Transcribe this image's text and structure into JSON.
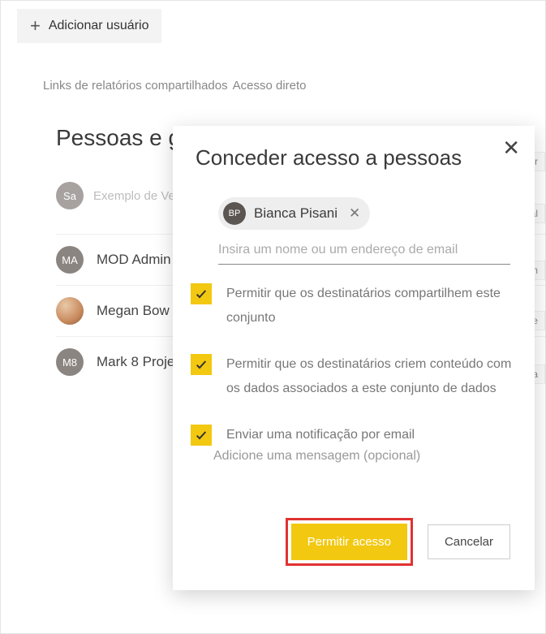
{
  "header": {
    "add_user_label": "Adicionar usuário"
  },
  "tabs": {
    "shared_links": "Links de relatórios compartilhados",
    "direct_access": "Acesso direto"
  },
  "main": {
    "heading_left": "Pessoas e grupos",
    "search_placeholder": "Exemplo de Vendas",
    "rows": [
      {
        "initials": "Sa",
        "name": "Exemplo de Vendas"
      },
      {
        "initials": "MA",
        "name": "MOD Admin"
      },
      {
        "initials": "",
        "name": "Megan Bow"
      },
      {
        "initials": "M8",
        "name": "Mark 8 Proje"
      }
    ],
    "right_tags": [
      "Er",
      "Sal",
      "adm",
      "Me",
      "Ma"
    ]
  },
  "dialog": {
    "title": "Conceder acesso a pessoas",
    "chip": {
      "initials": "BP",
      "name": "Bianca Pisani"
    },
    "name_placeholder": "Insira um nome ou um endereço de email",
    "options": [
      "Permitir que os destinatários compartilhem este conjunto",
      "Permitir que os destinatários criem conteúdo com os dados associados a este conjunto de dados",
      "Enviar uma notificação por email"
    ],
    "message_placeholder": "Adicione uma mensagem (opcional)",
    "primary_btn": "Permitir acesso",
    "secondary_btn": "Cancelar"
  }
}
